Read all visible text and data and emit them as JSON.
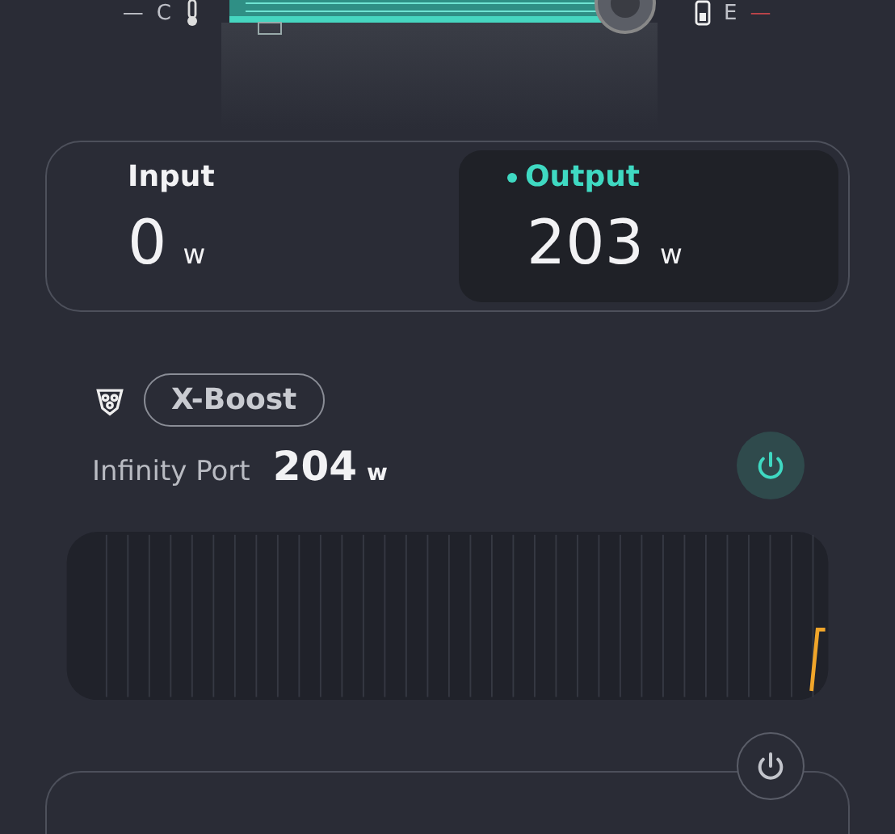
{
  "top_bar": {
    "left": [
      "—",
      "C"
    ],
    "right": [
      "E",
      "—"
    ]
  },
  "power_card": {
    "modes": [
      {
        "label": "Input",
        "value": "0",
        "unit": "w",
        "selected": false
      },
      {
        "label": "Output",
        "value": "203",
        "unit": "w",
        "selected": true
      }
    ]
  },
  "port": {
    "badge": "X-Boost",
    "name": "Infinity Port",
    "value": "204",
    "unit": "w",
    "on": true
  },
  "second_port": {
    "on": false
  }
}
